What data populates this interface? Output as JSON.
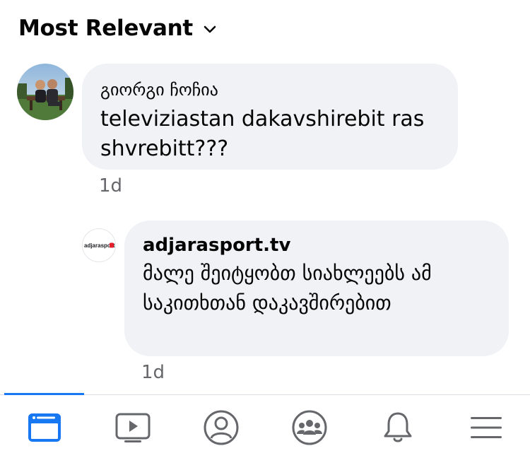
{
  "sort": {
    "label": "Most Relevant"
  },
  "comments": [
    {
      "author": "გიორგი ჩოჩია",
      "text": "televiziastan dakavshirebit ras shvrebitt???",
      "time": "1d"
    }
  ],
  "reply": {
    "author": "adjarasport.tv",
    "avatar_text": "adjarasport",
    "text": "მალე შეიტყობთ სიახლეებს ამ საკითხთან დაკავშირებით",
    "time": "1d"
  },
  "nav": {
    "items": [
      "feed-icon",
      "watch-icon",
      "profile-icon",
      "groups-icon",
      "notifications-icon",
      "menu-icon"
    ],
    "active": "feed-icon",
    "accent": "#1877f2",
    "inactive_color": "#65676b"
  }
}
